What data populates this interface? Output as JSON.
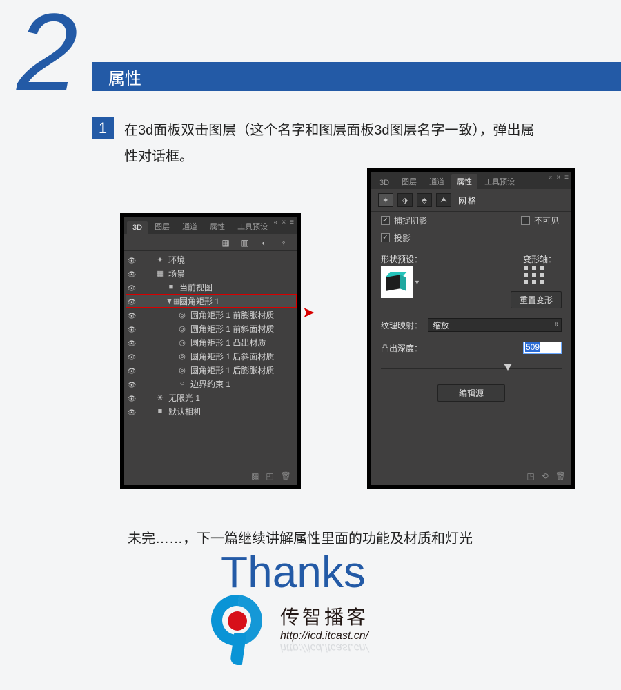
{
  "section": {
    "number": "2",
    "title": "属性"
  },
  "step": {
    "number": "1",
    "text": "在3d面板双击图层（这个名字和图层面板3d图层名字一致），弹出属性对话框。"
  },
  "left_panel": {
    "tabs": [
      "3D",
      "图层",
      "通道",
      "属性",
      "工具预设"
    ],
    "active_tab": "3D",
    "rows": [
      {
        "indent": 1,
        "icon": "✦",
        "label": "环境"
      },
      {
        "indent": 1,
        "icon": "▦",
        "label": "场景"
      },
      {
        "indent": 2,
        "icon": "■",
        "label": "当前视图"
      },
      {
        "indent": 2,
        "icon": "▼▦",
        "label": "圆角矩形 1",
        "selected": true
      },
      {
        "indent": 3,
        "icon": "◎",
        "label": "圆角矩形 1 前膨胀材质"
      },
      {
        "indent": 3,
        "icon": "◎",
        "label": "圆角矩形 1 前斜面材质"
      },
      {
        "indent": 3,
        "icon": "◎",
        "label": "圆角矩形 1 凸出材质"
      },
      {
        "indent": 3,
        "icon": "◎",
        "label": "圆角矩形 1 后斜面材质"
      },
      {
        "indent": 3,
        "icon": "◎",
        "label": "圆角矩形 1 后膨胀材质"
      },
      {
        "indent": 3,
        "icon": "○",
        "label": "边界约束 1"
      },
      {
        "indent": 1,
        "icon": "☀",
        "label": "无限光 1"
      },
      {
        "indent": 1,
        "icon": "■",
        "label": "默认相机"
      }
    ]
  },
  "right_panel": {
    "tabs": [
      "3D",
      "图层",
      "通道",
      "属性",
      "工具预设"
    ],
    "active_tab": "属性",
    "mode_title": "网格",
    "checks": {
      "catch_shadow": {
        "label": "捕捉阴影",
        "checked": true
      },
      "invisible": {
        "label": "不可见",
        "checked": false
      },
      "cast_shadow": {
        "label": "投影",
        "checked": true
      }
    },
    "shape_preset_label": "形状预设：",
    "deform_axis_label": "变形轴：",
    "reset_deform_btn": "重置变形",
    "texture_map_label": "纹理映射：",
    "texture_map_value": "缩放",
    "extrude_depth_label": "凸出深度：",
    "extrude_depth_value": "509",
    "edit_source_btn": "编辑源"
  },
  "outro": "未完……，下一篇继续讲解属性里面的功能及材质和灯光",
  "thanks": "Thanks",
  "brand": {
    "cn": "传智播客",
    "url": "http://icd.itcast.cn/"
  }
}
